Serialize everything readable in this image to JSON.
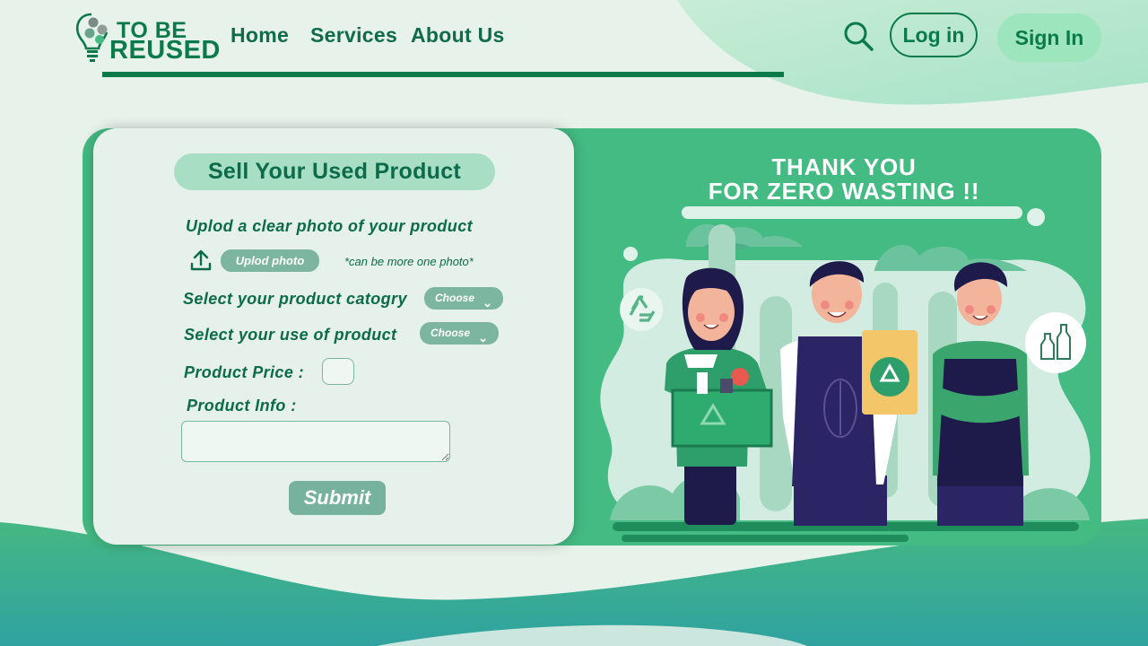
{
  "brand": {
    "line1": "TO BE",
    "line2": "REUSED"
  },
  "nav": {
    "home": "Home",
    "services": "Services",
    "about": "About Us"
  },
  "auth": {
    "login": "Log in",
    "signin": "Sign In"
  },
  "form": {
    "title": "Sell Your Used Product",
    "upload_prompt": "Uplod a clear photo of your product",
    "upload_button": "Uplod photo",
    "upload_note": "*can be more one photo*",
    "category_label": "Select your product catogry",
    "category_value": "Choose",
    "use_label": "Select your use of product",
    "use_value": "Choose",
    "price_label": "Product Price :",
    "info_label": "Product Info :",
    "submit": "Submit"
  },
  "banner": {
    "line1": "THANK YOU",
    "line2": "FOR ZERO WASTING !!"
  },
  "colors": {
    "primary": "#0b7a4b",
    "accent": "#44bb83",
    "light": "#a8dfc4",
    "background": "#e6f2ea"
  },
  "icons": {
    "search": "search-icon",
    "upload": "upload-icon",
    "chevron": "chevron-down-icon",
    "recycle": "recycle-icon",
    "bottle": "recycle-bottles-icon"
  }
}
